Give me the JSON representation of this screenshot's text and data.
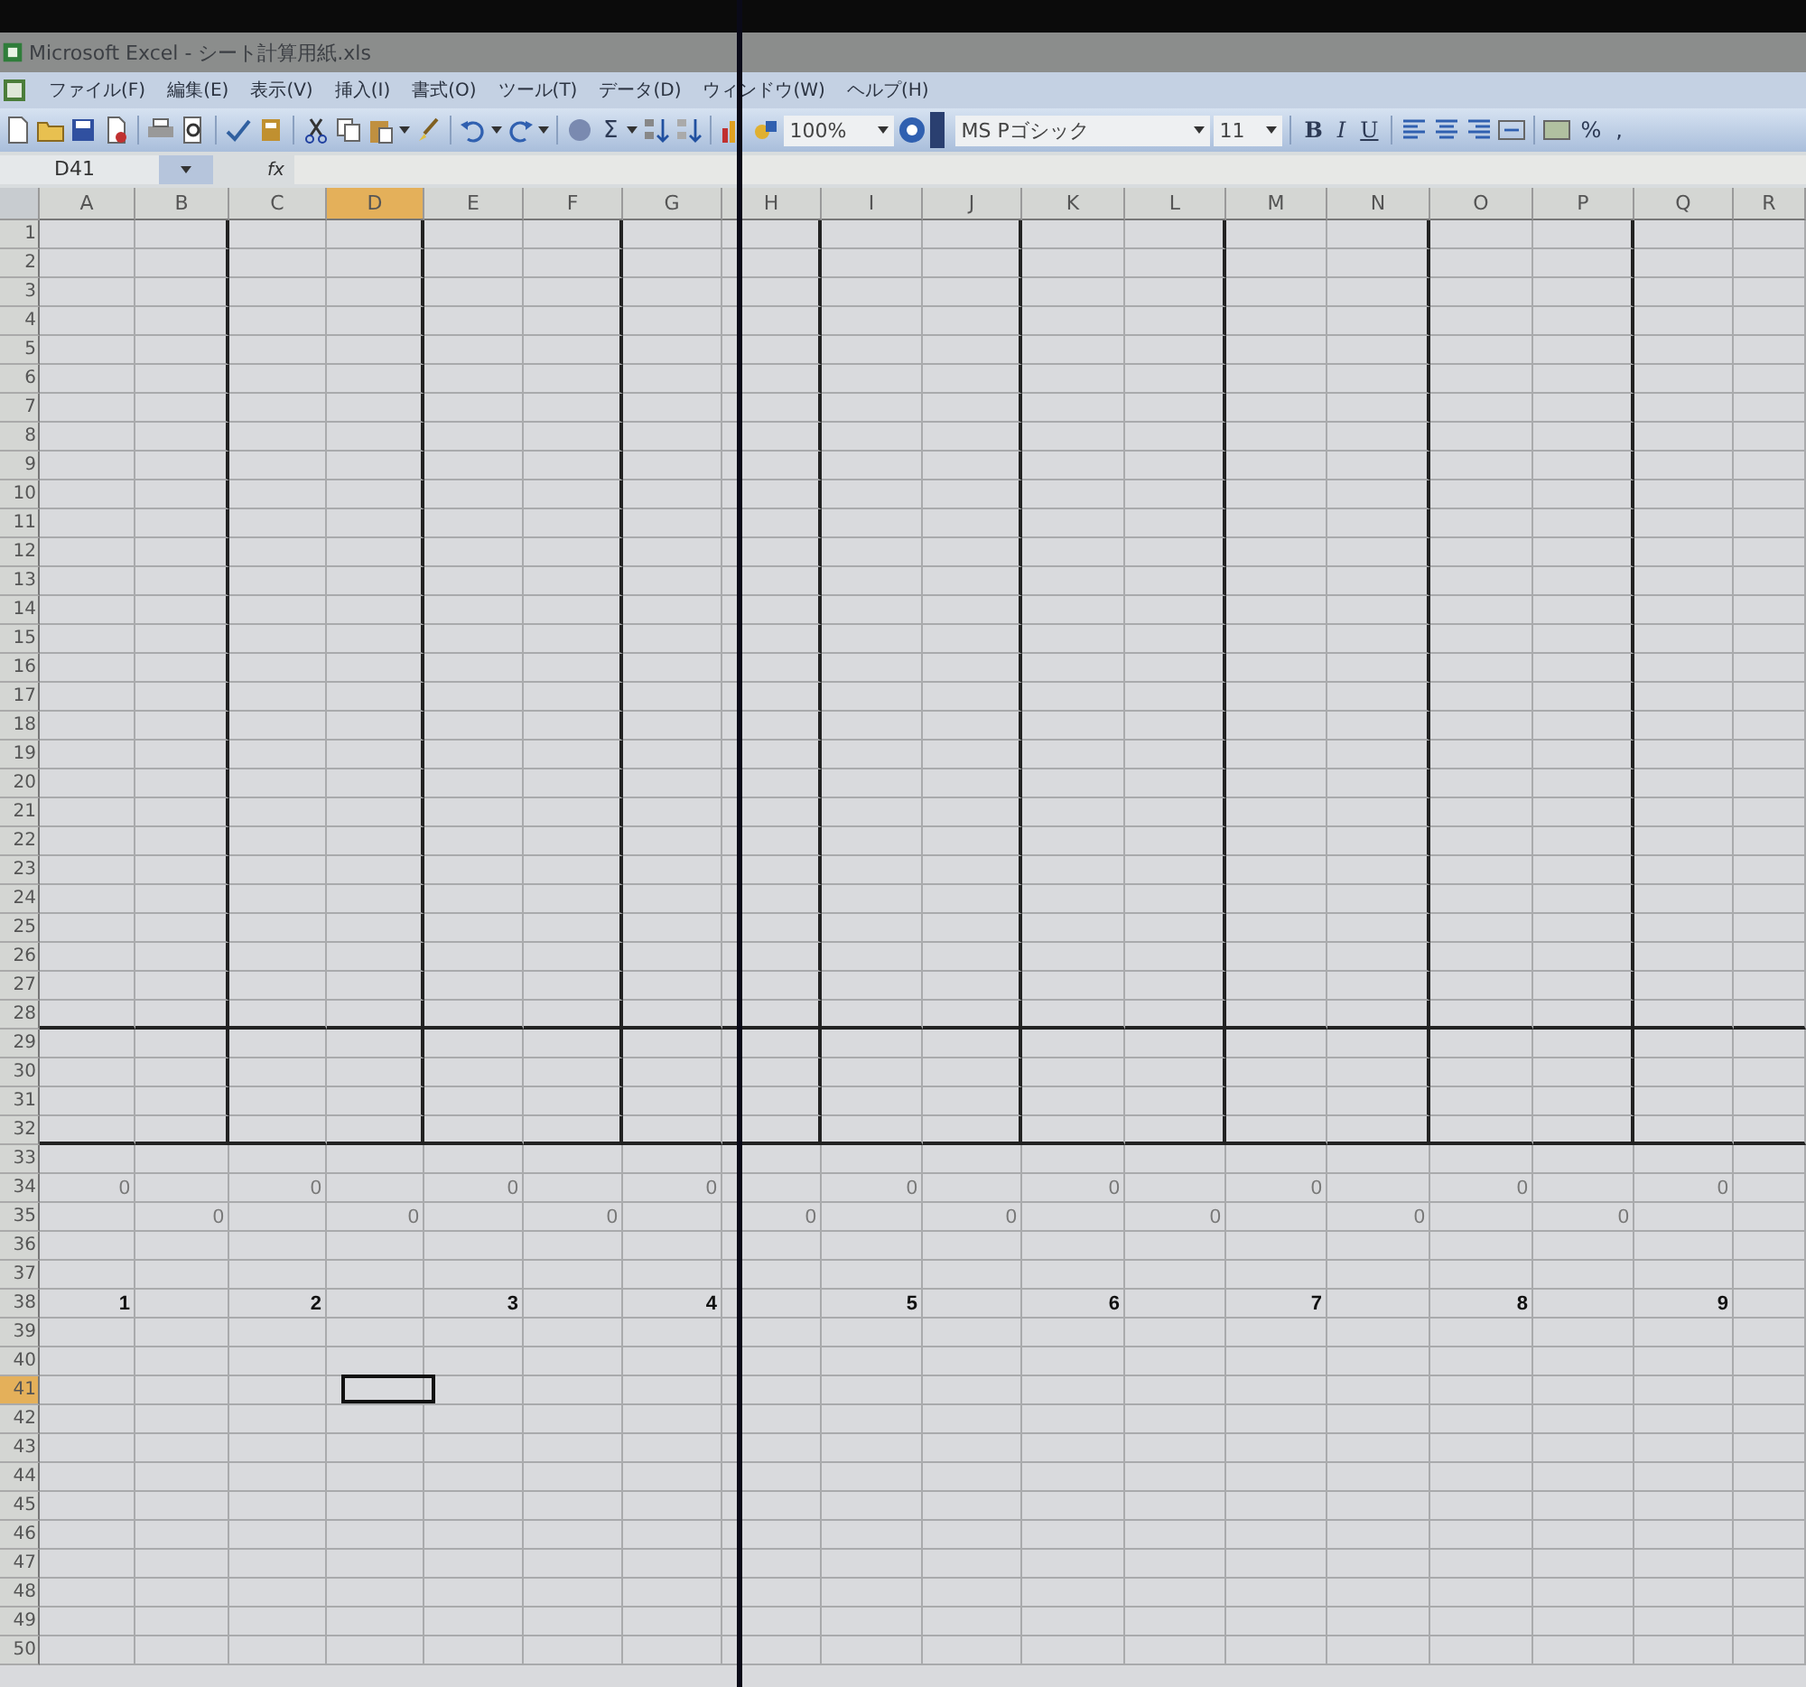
{
  "window": {
    "title": "Microsoft Excel - シート計算用紙.xls"
  },
  "menu": [
    {
      "label": "ファイル(F)"
    },
    {
      "label": "編集(E)"
    },
    {
      "label": "表示(V)"
    },
    {
      "label": "挿入(I)"
    },
    {
      "label": "書式(O)"
    },
    {
      "label": "ツール(T)"
    },
    {
      "label": "データ(D)"
    },
    {
      "label": "ウィンドウ(W)"
    },
    {
      "label": "ヘルプ(H)"
    }
  ],
  "toolbar": {
    "sum": "Σ",
    "zoom": "100%",
    "font": "MS Pゴシック",
    "size": "11",
    "bold": "B",
    "italic": "I",
    "underline": "U",
    "percent": "%",
    "comma": ","
  },
  "formula_bar": {
    "name_box": "D41",
    "fx": "fx"
  },
  "sheet": {
    "columns": [
      {
        "label": "A",
        "selected": false
      },
      {
        "label": "B",
        "selected": false
      },
      {
        "label": "C",
        "selected": false
      },
      {
        "label": "D",
        "selected": true
      },
      {
        "label": "E",
        "selected": false
      },
      {
        "label": "F",
        "selected": false
      },
      {
        "label": "G",
        "selected": false
      },
      {
        "label": "H",
        "selected": false
      },
      {
        "label": "I",
        "selected": false
      },
      {
        "label": "J",
        "selected": false
      },
      {
        "label": "K",
        "selected": false
      },
      {
        "label": "L",
        "selected": false
      },
      {
        "label": "M",
        "selected": false
      },
      {
        "label": "N",
        "selected": false
      },
      {
        "label": "O",
        "selected": false
      },
      {
        "label": "P",
        "selected": false
      },
      {
        "label": "Q",
        "selected": false
      },
      {
        "label": "R",
        "selected": false
      }
    ],
    "rows": [
      {
        "label": "1",
        "selected": false
      },
      {
        "label": "2",
        "selected": false
      },
      {
        "label": "3",
        "selected": false
      },
      {
        "label": "4",
        "selected": false
      },
      {
        "label": "5",
        "selected": false
      },
      {
        "label": "6",
        "selected": false
      },
      {
        "label": "7",
        "selected": false
      },
      {
        "label": "8",
        "selected": false
      },
      {
        "label": "9",
        "selected": false
      },
      {
        "label": "10",
        "selected": false
      },
      {
        "label": "11",
        "selected": false
      },
      {
        "label": "12",
        "selected": false
      },
      {
        "label": "13",
        "selected": false
      },
      {
        "label": "14",
        "selected": false
      },
      {
        "label": "15",
        "selected": false
      },
      {
        "label": "16",
        "selected": false
      },
      {
        "label": "17",
        "selected": false
      },
      {
        "label": "18",
        "selected": false
      },
      {
        "label": "19",
        "selected": false
      },
      {
        "label": "20",
        "selected": false
      },
      {
        "label": "21",
        "selected": false
      },
      {
        "label": "22",
        "selected": false
      },
      {
        "label": "23",
        "selected": false
      },
      {
        "label": "24",
        "selected": false
      },
      {
        "label": "25",
        "selected": false
      },
      {
        "label": "26",
        "selected": false
      },
      {
        "label": "27",
        "selected": false
      },
      {
        "label": "28",
        "selected": false
      },
      {
        "label": "29",
        "selected": false
      },
      {
        "label": "30",
        "selected": false
      },
      {
        "label": "31",
        "selected": false
      },
      {
        "label": "32",
        "selected": false
      },
      {
        "label": "33",
        "selected": false
      },
      {
        "label": "34",
        "selected": false,
        "bold": false,
        "cells": [
          "0",
          null,
          "0",
          null,
          "0",
          null,
          "0",
          null,
          "0",
          null,
          "0",
          null,
          "0",
          null,
          "0",
          null,
          "0",
          null
        ]
      },
      {
        "label": "35",
        "selected": false,
        "bold": false,
        "cells": [
          null,
          "0",
          null,
          "0",
          null,
          "0",
          null,
          "0",
          null,
          "0",
          null,
          "0",
          null,
          "0",
          null,
          "0",
          null,
          null
        ]
      },
      {
        "label": "36",
        "selected": false
      },
      {
        "label": "37",
        "selected": false
      },
      {
        "label": "38",
        "selected": false,
        "bold": true,
        "cells": [
          "1",
          null,
          "2",
          null,
          "3",
          null,
          "4",
          null,
          "5",
          null,
          "6",
          null,
          "7",
          null,
          "8",
          null,
          "9",
          null
        ]
      },
      {
        "label": "39",
        "selected": false
      },
      {
        "label": "40",
        "selected": false
      },
      {
        "label": "41",
        "selected": true
      },
      {
        "label": "42",
        "selected": false
      },
      {
        "label": "43",
        "selected": false
      },
      {
        "label": "44",
        "selected": false
      },
      {
        "label": "45",
        "selected": false
      },
      {
        "label": "46",
        "selected": false
      },
      {
        "label": "47",
        "selected": false
      },
      {
        "label": "48",
        "selected": false
      },
      {
        "label": "49",
        "selected": false
      },
      {
        "label": "50",
        "selected": false
      }
    ]
  }
}
